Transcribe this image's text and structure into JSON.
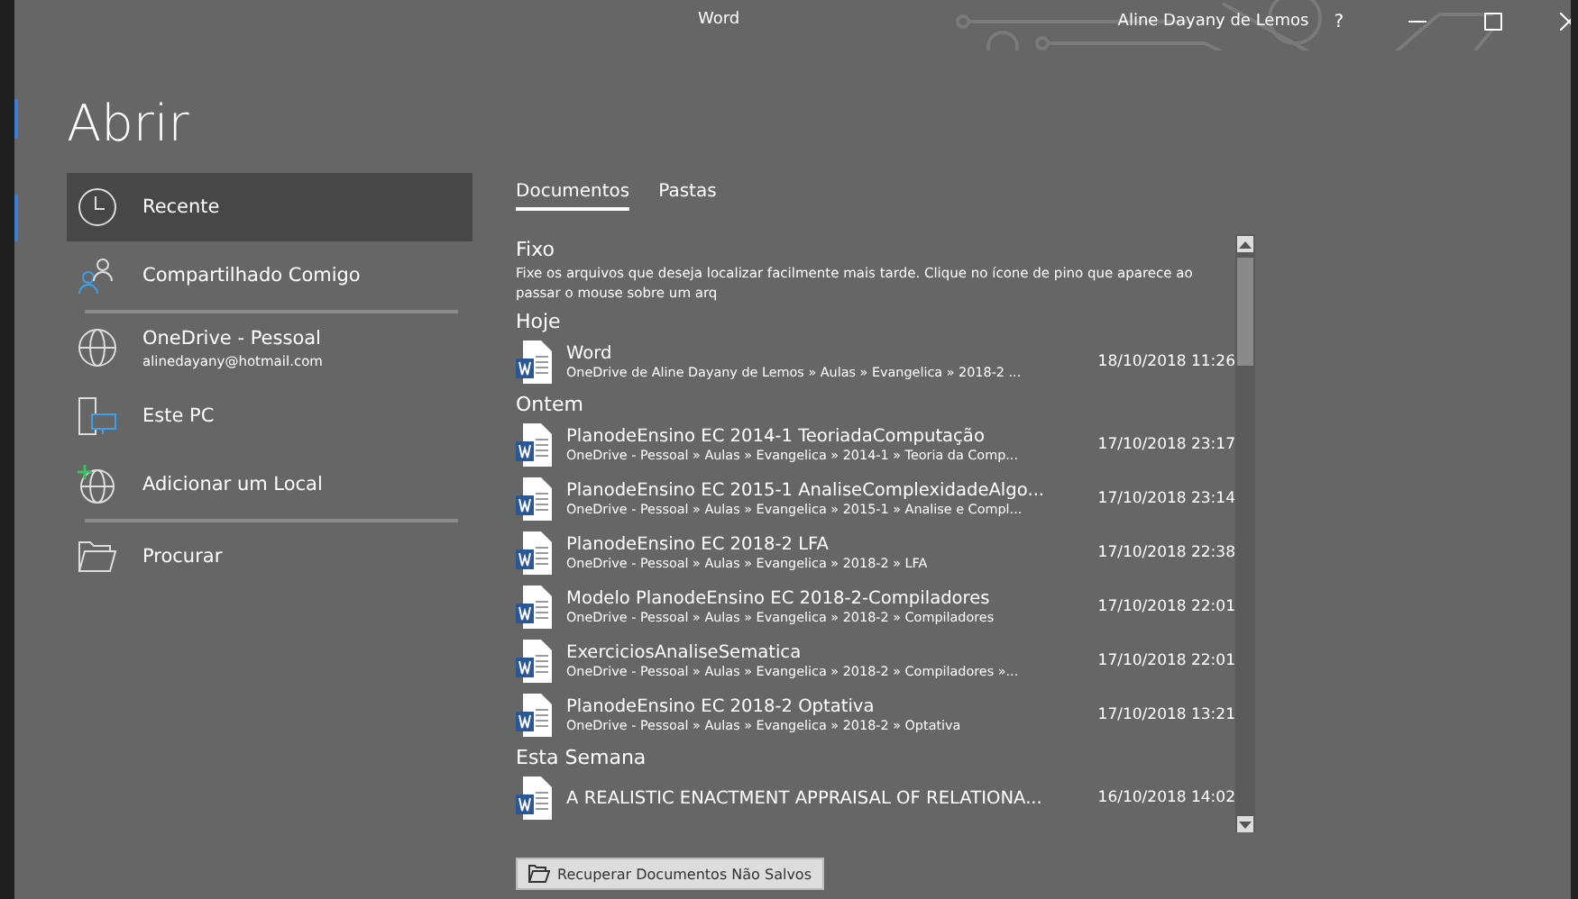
{
  "window": {
    "title": "Word",
    "user": "Aline Dayany de Lemos",
    "help": "?"
  },
  "heading": "Abrir",
  "places": [
    {
      "label": "Recente",
      "selected": true,
      "divider_after": false
    },
    {
      "label": "Compartilhado Comigo",
      "selected": false,
      "divider_after": true
    },
    {
      "label": "OneDrive - Pessoal",
      "subtitle": "alinedayany@hotmail.com",
      "selected": false,
      "divider_after": false
    },
    {
      "label": "Este PC",
      "selected": false,
      "divider_after": false
    },
    {
      "label": "Adicionar um Local",
      "selected": false,
      "divider_after": true
    },
    {
      "label": "Procurar",
      "selected": false,
      "divider_after": false
    }
  ],
  "tabs": [
    {
      "label": "Documentos",
      "selected": true
    },
    {
      "label": "Pastas",
      "selected": false
    }
  ],
  "sections": [
    {
      "title": "Fixo",
      "note": "Fixe os arquivos que deseja localizar facilmente mais tarde. Clique no ícone de pino que aparece ao passar o mouse sobre um arq"
    },
    {
      "title": "Hoje",
      "files": [
        {
          "name": "Word",
          "path": "OneDrive de Aline Dayany de Lemos » Aulas » Evangelica » 2018-2 ...",
          "date": "18/10/2018 11:26"
        }
      ]
    },
    {
      "title": "Ontem",
      "files": [
        {
          "name": "PlanodeEnsino EC 2014-1 TeoriadaComputação",
          "path": "OneDrive - Pessoal » Aulas » Evangelica » 2014-1 » Teoria da Comp...",
          "date": "17/10/2018 23:17"
        },
        {
          "name": "PlanodeEnsino EC 2015-1 AnaliseComplexidadeAlgo...",
          "path": "OneDrive - Pessoal » Aulas » Evangelica » 2015-1 » Analise e Compl...",
          "date": "17/10/2018 23:14"
        },
        {
          "name": "PlanodeEnsino EC 2018-2 LFA",
          "path": "OneDrive - Pessoal » Aulas » Evangelica » 2018-2 » LFA",
          "date": "17/10/2018 22:38"
        },
        {
          "name": "Modelo PlanodeEnsino EC 2018-2-Compiladores",
          "path": "OneDrive - Pessoal » Aulas » Evangelica » 2018-2 » Compiladores",
          "date": "17/10/2018 22:01"
        },
        {
          "name": "ExerciciosAnaliseSematica",
          "path": "OneDrive - Pessoal » Aulas » Evangelica » 2018-2 » Compiladores »...",
          "date": "17/10/2018 22:01"
        },
        {
          "name": "PlanodeEnsino EC 2018-2 Optativa",
          "path": "OneDrive - Pessoal » Aulas » Evangelica » 2018-2 » Optativa",
          "date": "17/10/2018 13:21"
        }
      ]
    },
    {
      "title": "Esta Semana",
      "files": [
        {
          "name": "A REALISTIC ENACTMENT APPRAISAL OF RELATIONA...",
          "date": "16/10/2018 14:02"
        }
      ]
    }
  ],
  "recover_button": "Recuperar Documentos Não Salvos"
}
